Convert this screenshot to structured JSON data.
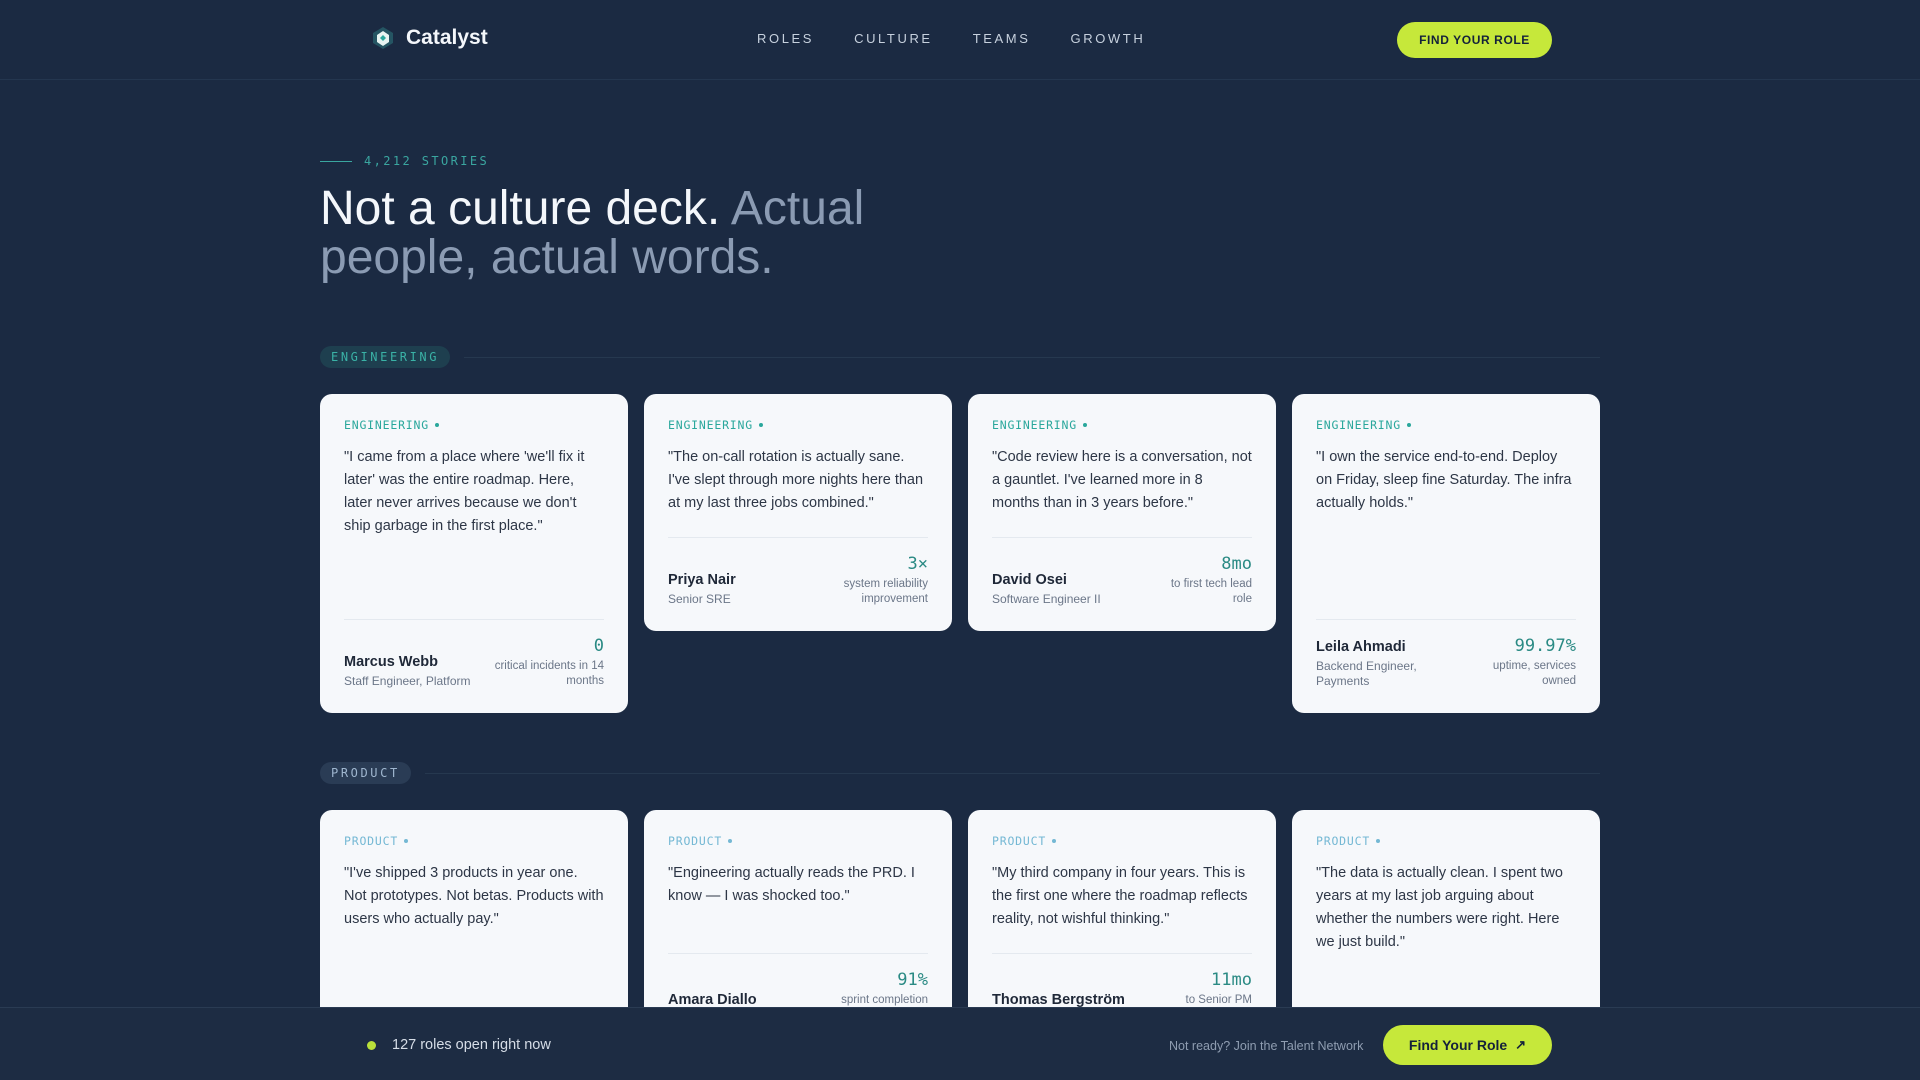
{
  "brand": {
    "name": "Catalyst"
  },
  "nav": {
    "items": [
      "ROLES",
      "CULTURE",
      "TEAMS",
      "GROWTH"
    ]
  },
  "header": {
    "cta_label": "FIND YOUR ROLE"
  },
  "hero": {
    "eyebrow": "4,212 STORIES",
    "title_main": "Not a culture deck.",
    "title_muted": "Actual people, actual words."
  },
  "sections": {
    "engineering": {
      "label": "ENGINEERING",
      "cards": [
        {
          "category": "ENGINEERING",
          "quote": "\"I came from a place where 'we'll fix it later' was the entire roadmap. Here, later never arrives because we don't ship garbage in the first place.\"",
          "name": "Marcus Webb",
          "role": "Staff Engineer, Platform",
          "metric_value": "0",
          "metric_label": "critical incidents in 14 months"
        },
        {
          "category": "ENGINEERING",
          "quote": "\"The on-call rotation is actually sane. I've slept through more nights here than at my last three jobs combined.\"",
          "name": "Priya Nair",
          "role": "Senior SRE",
          "metric_value": "3×",
          "metric_label": "system reliability improvement"
        },
        {
          "category": "ENGINEERING",
          "quote": "\"Code review here is a conversation, not a gauntlet. I've learned more in 8 months than in 3 years before.\"",
          "name": "David Osei",
          "role": "Software Engineer II",
          "metric_value": "8mo",
          "metric_label": "to first tech lead role"
        },
        {
          "category": "ENGINEERING",
          "quote": "\"I own the service end-to-end. Deploy on Friday, sleep fine Saturday. The infra actually holds.\"",
          "name": "Leila Ahmadi",
          "role": "Backend Engineer, Payments",
          "metric_value": "99.97%",
          "metric_label": "uptime, services owned"
        }
      ]
    },
    "product": {
      "label": "PRODUCT",
      "cards": [
        {
          "category": "PRODUCT",
          "quote": "\"I've shipped 3 products in year one. Not prototypes. Not betas. Products with users who actually pay.\"",
          "name": "",
          "role": "",
          "metric_value": "",
          "metric_label": ""
        },
        {
          "category": "PRODUCT",
          "quote": "\"Engineering actually reads the PRD. I know — I was shocked too.\"",
          "name": "Amara Diallo",
          "role": "",
          "metric_value": "91%",
          "metric_label": "sprint completion"
        },
        {
          "category": "PRODUCT",
          "quote": "\"My third company in four years. This is the first one where the roadmap reflects reality, not wishful thinking.\"",
          "name": "Thomas Bergström",
          "role": "",
          "metric_value": "11mo",
          "metric_label": "to Senior PM"
        },
        {
          "category": "PRODUCT",
          "quote": "\"The data is actually clean. I spent two years at my last job arguing about whether the numbers were right. Here we just build.\"",
          "name": "",
          "role": "",
          "metric_value": "",
          "metric_label": ""
        }
      ]
    }
  },
  "bottom_bar": {
    "roles_open": "127 roles open right now",
    "network_link": "Not ready? Join the Talent Network",
    "cta_label": "Find Your Role"
  },
  "colors": {
    "background": "#1b2a42",
    "accent": "#c6e83a",
    "teal": "#2aa79c",
    "card": "#f6f8fb"
  },
  "icons": {
    "brand": "catalyst-logo-icon",
    "status": "status-dot-icon",
    "cta": "arrow-up-right-icon"
  }
}
